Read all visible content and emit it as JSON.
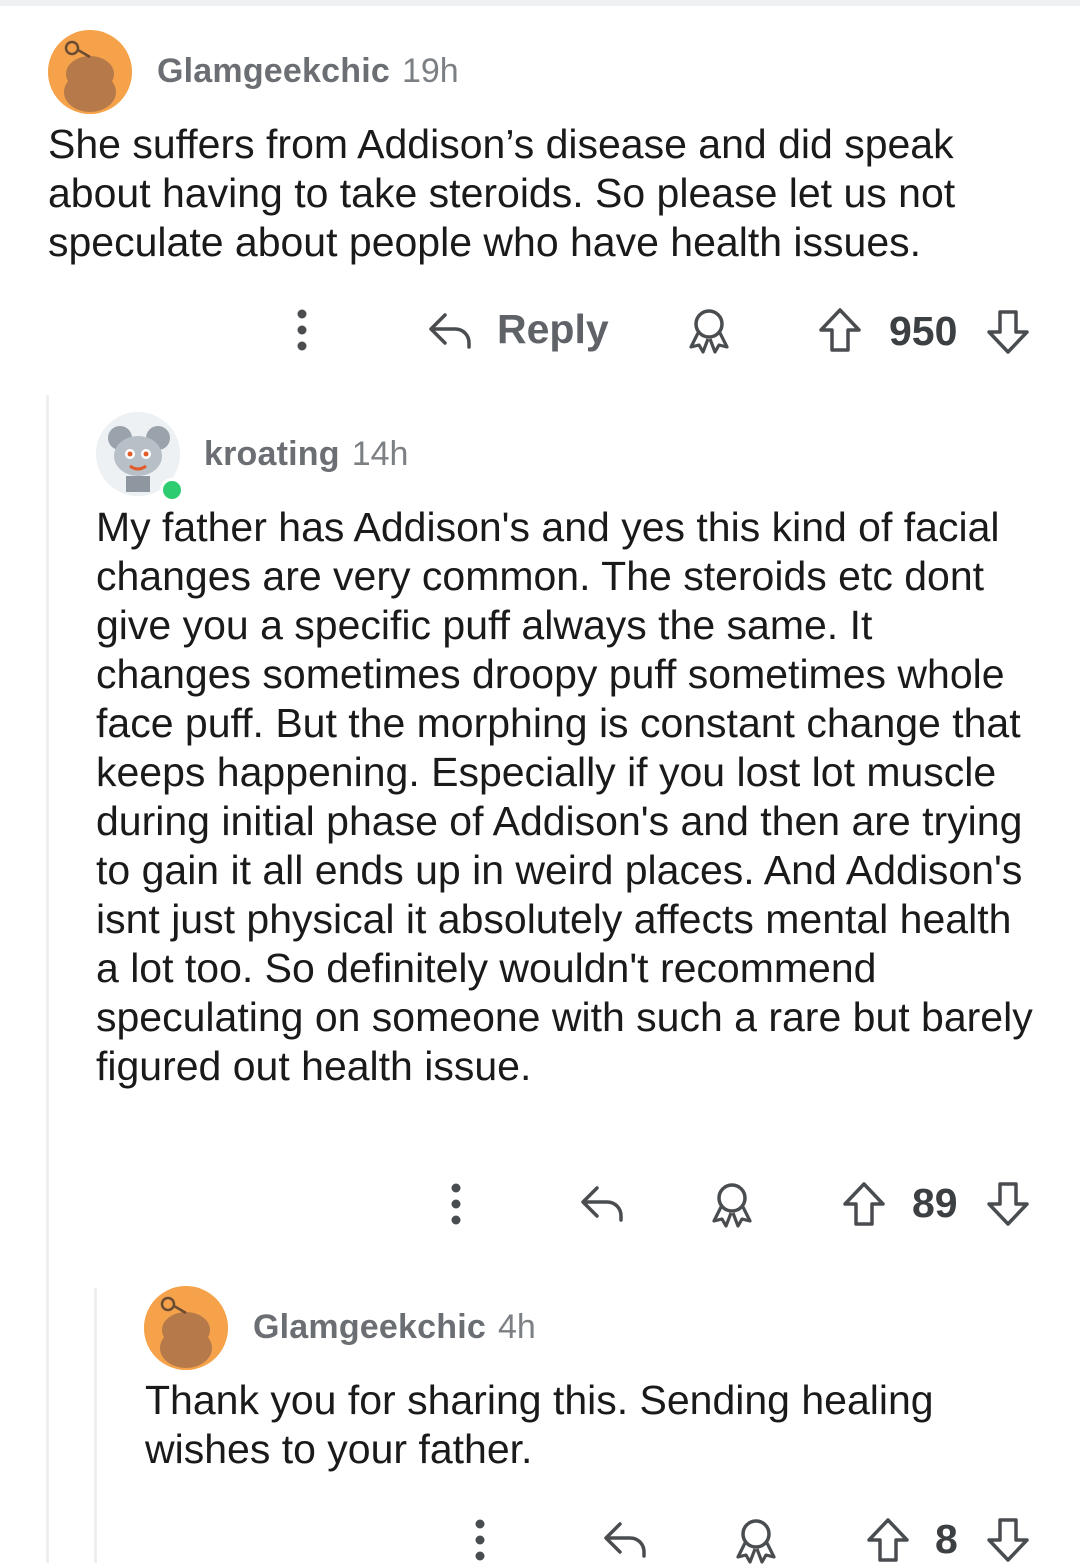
{
  "comments": [
    {
      "username": "Glamgeekchic",
      "age": "19h",
      "body": "She suffers from Addison’s disease and did speak about having to take steroids. So please let us not speculate about people who have health issues.",
      "reply_label": "Reply",
      "score": "950",
      "avatar_color": "#f5a24a"
    },
    {
      "username": "kroating",
      "age": "14h",
      "body": "My father has Addison's and yes this kind of facial changes are very common. The steroids etc dont give you a specific puff always the same. It changes sometimes droopy puff sometimes whole face puff. But the morphing is constant change that keeps happening. Especially if you lost lot muscle during initial phase of Addison's and then are trying to gain it all ends up in weird places. And Addison's isnt just physical it absolutely affects mental health a lot too. So definitely wouldn't recommend speculating on someone with such a rare but barely figured out health issue.",
      "score": "89",
      "online": true
    },
    {
      "username": "Glamgeekchic",
      "age": "4h",
      "body": "Thank you for sharing this. Sending healing wishes to your father.",
      "score": "8",
      "avatar_color": "#f5a24a"
    }
  ],
  "icons": {
    "more": "vertical-ellipsis-icon",
    "reply": "reply-arrow-icon",
    "award": "award-icon",
    "upvote": "upvote-arrow-icon",
    "downvote": "downvote-arrow-icon",
    "online": "online-status-dot"
  },
  "colors": {
    "online": "#2ecc71",
    "avatar_orange": "#f5a24a",
    "text_muted": "#6b6f73"
  }
}
